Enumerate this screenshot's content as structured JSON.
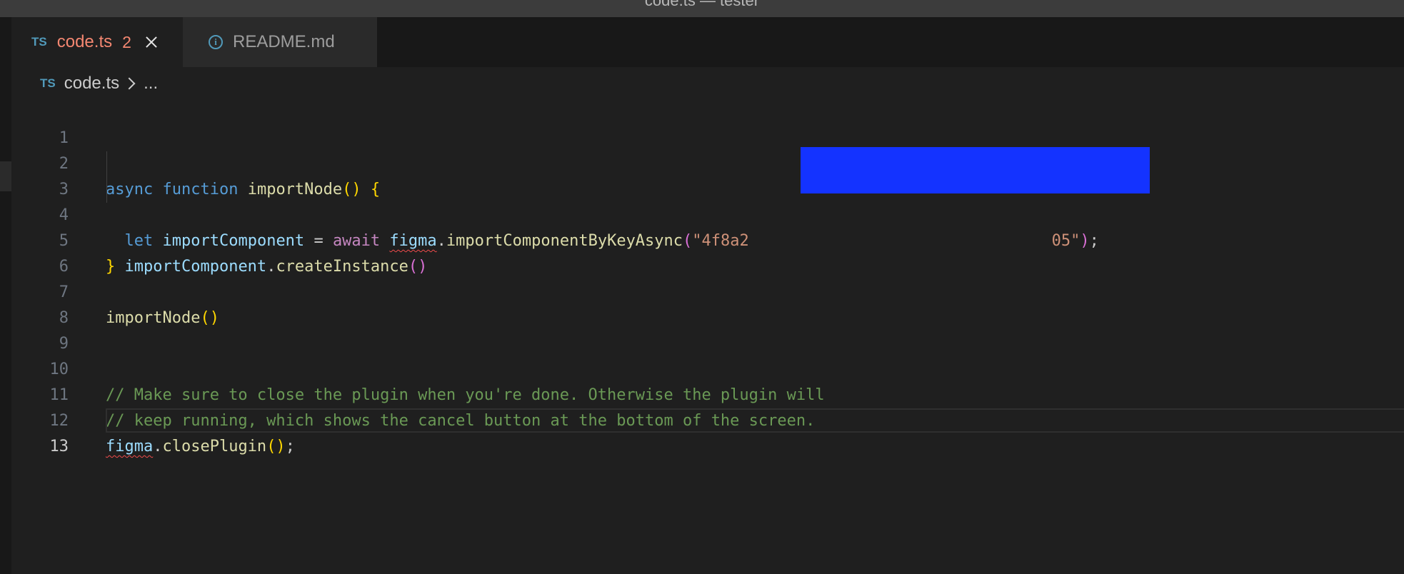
{
  "window": {
    "title": "code.ts — tester"
  },
  "tabs": [
    {
      "icon": "TS",
      "label": "code.ts",
      "problems": "2",
      "active": true
    },
    {
      "icon": "info",
      "label": "README.md",
      "active": false
    }
  ],
  "breadcrumb": {
    "icon": "TS",
    "file": "code.ts",
    "more": "..."
  },
  "editor": {
    "line_numbers": [
      "1",
      "2",
      "3",
      "4",
      "5",
      "6",
      "7",
      "8",
      "9",
      "10",
      "11",
      "12",
      "13"
    ],
    "current_line": "13",
    "lines": {
      "l2": {
        "kw1": "async",
        "kw2": "function",
        "fn": "importNode",
        "open": "()",
        "brace": "{"
      },
      "l3": {
        "kw": "let",
        "var": "importComponent",
        "eq": "=",
        "await": "await",
        "obj": "figma",
        "dot": ".",
        "method": "importComponentByKeyAsync",
        "open": "(",
        "str_start": "\"4f8a2",
        "str_end": "05\"",
        "close": ")",
        "semi": ";"
      },
      "l4": {
        "var": "importComponent",
        "dot": ".",
        "method": "createInstance",
        "parens": "()"
      },
      "l5": {
        "brace": "}"
      },
      "l7": {
        "fn": "importNode",
        "parens": "()"
      },
      "l10": {
        "comment": "// Make sure to close the plugin when you're done. Otherwise the plugin will"
      },
      "l11": {
        "comment": "// keep running, which shows the cancel button at the bottom of the screen."
      },
      "l12": {
        "obj": "figma",
        "dot": ".",
        "method": "closePlugin",
        "parens": "()",
        "semi": ";"
      }
    }
  },
  "colors": {
    "keyword": "#569cd6",
    "control": "#c586c0",
    "function": "#dcdcaa",
    "variable": "#9cdcfe",
    "string": "#ce9178",
    "comment": "#6a9955",
    "error": "#f48771",
    "redaction": "#1433ff"
  }
}
